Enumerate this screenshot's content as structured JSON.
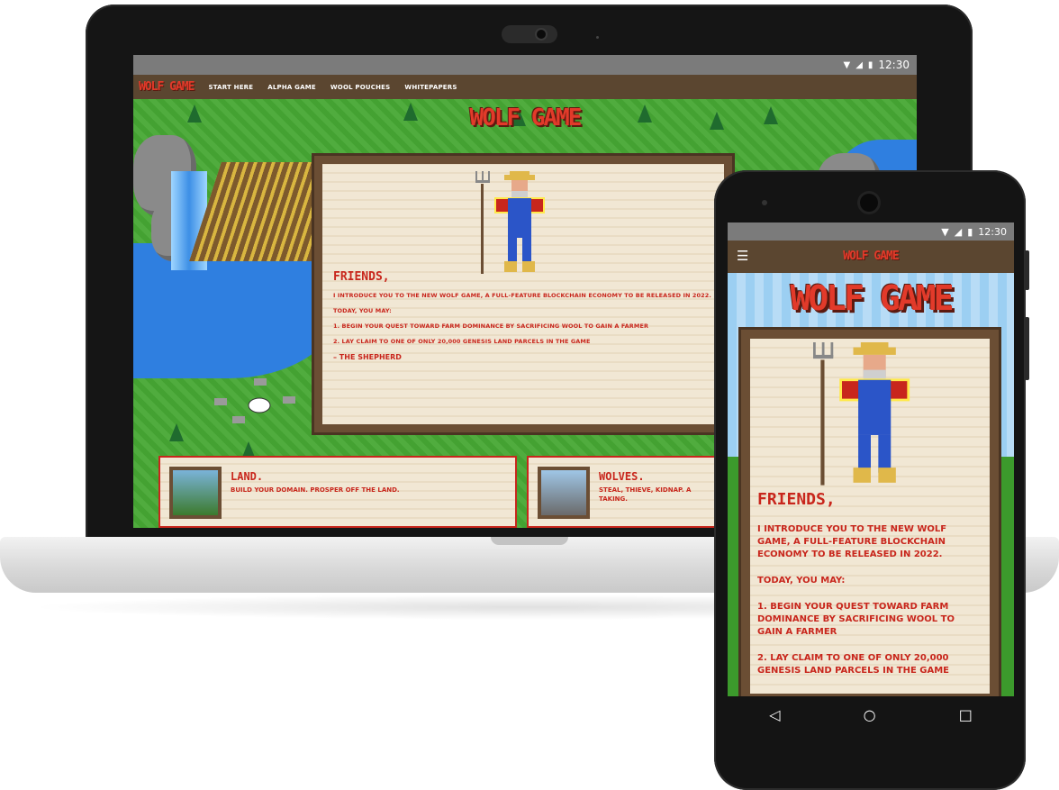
{
  "laptop": {
    "status_time": "12:30",
    "nav": {
      "logo": "WOLF GAME",
      "links": [
        "START HERE",
        "ALPHA GAME",
        "WOOL POUCHES",
        "WHITEPAPERS"
      ]
    },
    "hero_title": "WOLF GAME",
    "notice": {
      "heading": "FRIENDS,",
      "lines": [
        "I INTRODUCE YOU TO THE NEW WOLF GAME, A FULL-FEATURE BLOCKCHAIN ECONOMY TO BE RELEASED IN 2022.",
        "TODAY, YOU MAY:",
        "1. BEGIN YOUR QUEST TOWARD FARM DOMINANCE BY SACRIFICING WOOL TO GAIN A FARMER",
        "2. LAY CLAIM TO ONE OF ONLY 20,000 GENESIS LAND PARCELS IN THE GAME"
      ],
      "signature": "– THE SHEPHERD"
    },
    "cards": [
      {
        "title": "LAND.",
        "desc": "BUILD YOUR DOMAIN. PROSPER OFF THE LAND."
      },
      {
        "title": "WOLVES.",
        "desc": "STEAL, THIEVE, KIDNAP. A TAKING."
      }
    ]
  },
  "phone": {
    "status_time": "12:30",
    "logo": "WOLF GAME",
    "menu_icon": "menu-icon",
    "hero_title": "WOLF GAME",
    "notice": {
      "heading": "FRIENDS,",
      "lines": [
        "I INTRODUCE YOU TO THE NEW WOLF GAME, A FULL-FEATURE BLOCKCHAIN ECONOMY TO BE RELEASED IN 2022.",
        "TODAY, YOU MAY:",
        "1. BEGIN YOUR QUEST TOWARD FARM DOMINANCE BY SACRIFICING WOOL TO GAIN A FARMER",
        "2. LAY CLAIM TO ONE OF ONLY 20,000 GENESIS LAND PARCELS IN THE GAME"
      ]
    },
    "nav_buttons": [
      "back-icon",
      "home-icon",
      "recents-icon"
    ]
  },
  "colors": {
    "brand_red": "#c8261c",
    "nav_brown": "#5b4630",
    "parchment": "#f1e7d4",
    "grass": "#47a834"
  }
}
